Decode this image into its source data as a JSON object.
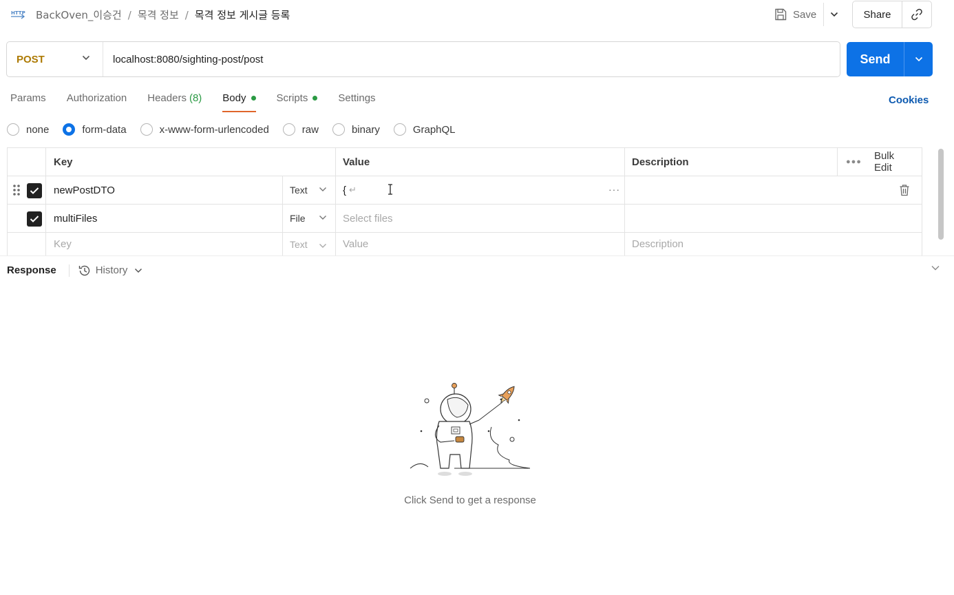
{
  "breadcrumb": {
    "request_type": "HTTP",
    "items": [
      "BackOven_이승건",
      "목격 정보",
      "목격 정보 게시글 등록"
    ],
    "separator": "/"
  },
  "toolbar": {
    "save_label": "Save",
    "share_label": "Share"
  },
  "request": {
    "method": "POST",
    "url": "localhost:8080/sighting-post/post",
    "send_label": "Send"
  },
  "tabs": {
    "params": "Params",
    "authorization": "Authorization",
    "headers": "Headers",
    "headers_count": "(8)",
    "body": "Body",
    "scripts": "Scripts",
    "settings": "Settings",
    "cookies": "Cookies",
    "active": "Body"
  },
  "body_types": {
    "options": [
      "none",
      "form-data",
      "x-www-form-urlencoded",
      "raw",
      "binary",
      "GraphQL"
    ],
    "selected": "form-data"
  },
  "table": {
    "headers": {
      "key": "Key",
      "value": "Value",
      "description": "Description",
      "bulk_edit": "Bulk Edit"
    },
    "rows": [
      {
        "checked": true,
        "key": "newPostDTO",
        "type": "Text",
        "value": "{",
        "value_continuation": "↵",
        "description": ""
      },
      {
        "checked": true,
        "key": "multiFiles",
        "type": "File",
        "value_placeholder": "Select files",
        "description": ""
      }
    ],
    "new_row": {
      "key_placeholder": "Key",
      "type": "Text",
      "value_placeholder": "Value",
      "description_placeholder": "Description"
    }
  },
  "response": {
    "title": "Response",
    "history_label": "History",
    "empty_message": "Click Send to get a response"
  },
  "colors": {
    "send": "#0d72e6",
    "method": "#ad7a03",
    "tab_indicator": "#e0652b",
    "dot": "#2b9a44",
    "cookies": "#0d5ab0"
  }
}
